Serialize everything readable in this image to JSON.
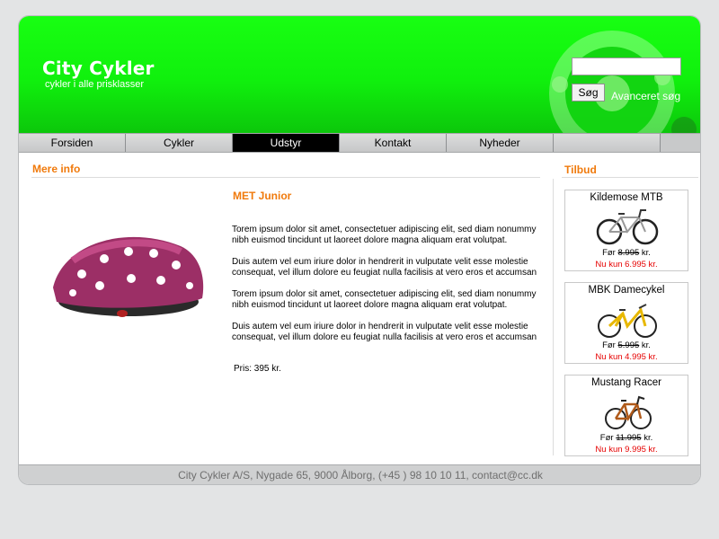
{
  "header": {
    "site_title": "City Cykler",
    "tagline": "cykler i alle prisklasser",
    "search": {
      "value": "",
      "button_label": "Søg",
      "advanced_link": "Avanceret søg"
    }
  },
  "nav": {
    "items": [
      {
        "label": "Forsiden",
        "active": false
      },
      {
        "label": "Cykler",
        "active": false
      },
      {
        "label": "Udstyr",
        "active": true
      },
      {
        "label": "Kontakt",
        "active": false
      },
      {
        "label": "Nyheder",
        "active": false
      },
      {
        "label": "",
        "active": false
      }
    ]
  },
  "main": {
    "section_title": "Mere info",
    "product": {
      "title": "MET Junior",
      "paragraphs": [
        "Torem ipsum dolor sit amet, consectetuer adipiscing elit, sed diam nonummy nibh euismod tincidunt ut laoreet dolore magna aliquam erat volutpat.",
        "Duis autem vel eum iriure dolor in hendrerit in vulputate velit esse molestie consequat, vel illum dolore eu feugiat nulla facilisis at vero eros et accumsan",
        "Torem ipsum dolor sit amet, consectetuer adipiscing elit, sed diam nonummy nibh euismod tincidunt ut laoreet dolore magna aliquam erat volutpat.",
        "Duis autem vel eum iriure dolor in hendrerit in vulputate velit esse molestie consequat, vel illum dolore eu feugiat nulla facilisis at vero eros et accumsan"
      ],
      "price": "Pris: 395 kr."
    }
  },
  "offers": {
    "section_title": "Tilbud",
    "items": [
      {
        "name": "Kildemose MTB",
        "before_label": "Før",
        "before_price": "8.995",
        "before_unit": "kr.",
        "now": "Nu kun 6.995 kr."
      },
      {
        "name": "MBK Damecykel",
        "before_label": "Før",
        "before_price": "5.995",
        "before_unit": "kr.",
        "now": "Nu kun 4.995 kr."
      },
      {
        "name": "Mustang Racer",
        "before_label": "Før",
        "before_price": "11.995",
        "before_unit": "kr.",
        "now": "Nu kun 9.995 kr."
      }
    ]
  },
  "footer": {
    "text": "City Cykler A/S, Nygade 65, 9000 Ålborg, (+45 ) 98 10 10 11, contact@cc.dk"
  },
  "colors": {
    "header_green": "#10f00d",
    "accent_orange": "#f07a0c",
    "offer_red": "#e60000",
    "nav_active": "#000000"
  },
  "icons": [
    "chainring-gear-graphic",
    "bike-helmet-image",
    "mountain-bike-image",
    "city-bike-image",
    "racer-bike-image"
  ]
}
